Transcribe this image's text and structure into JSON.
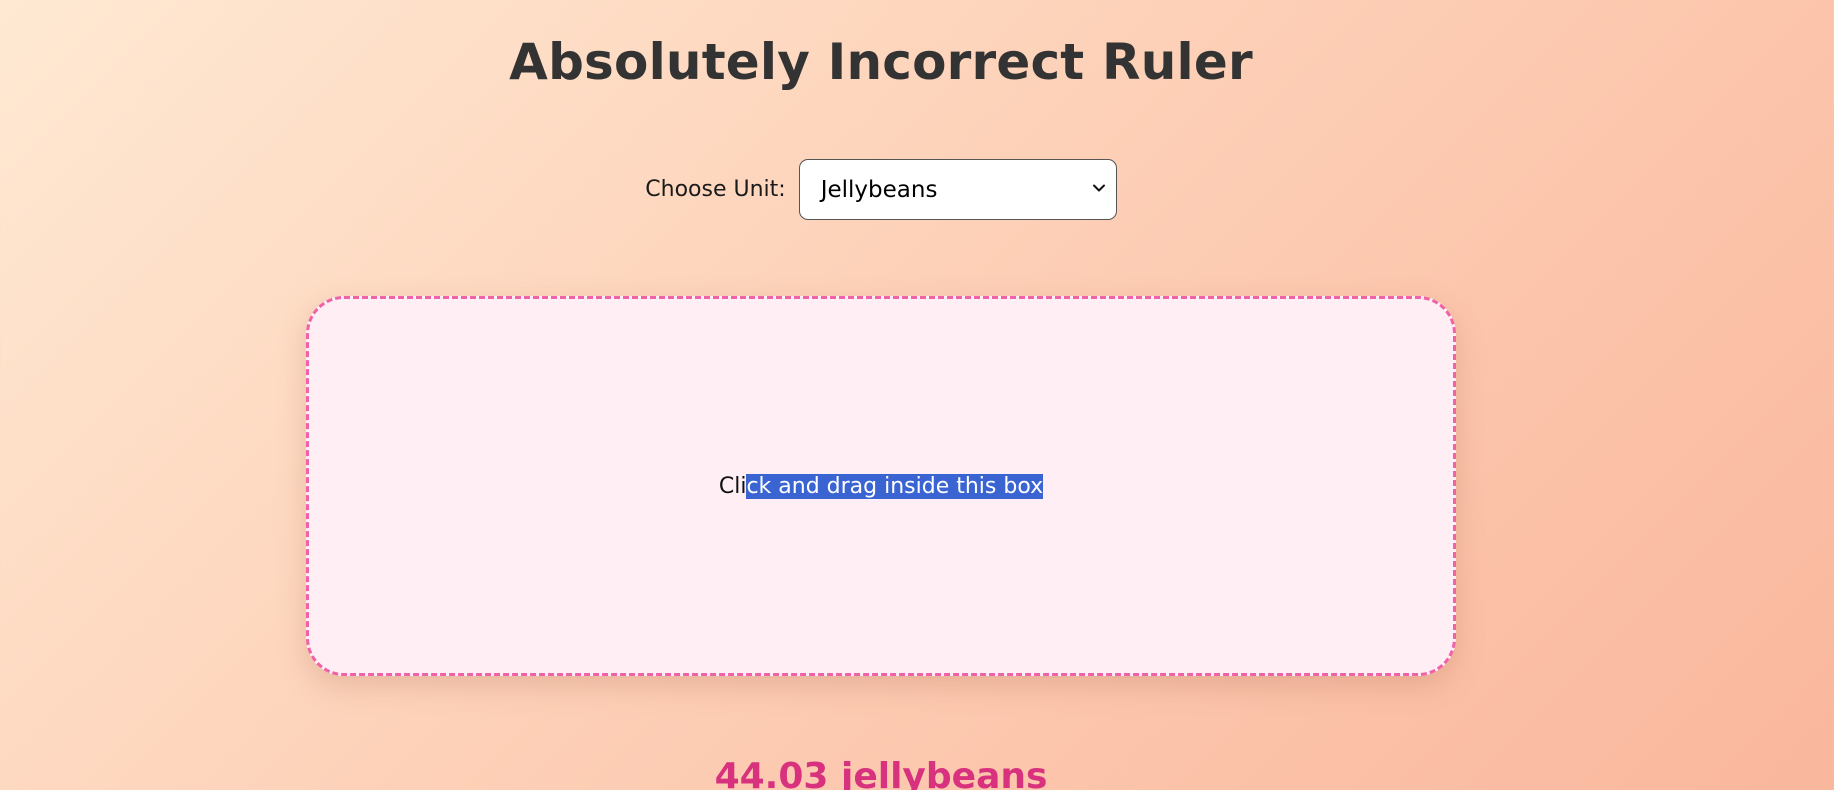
{
  "header": {
    "title": "Absolutely Incorrect Ruler"
  },
  "controls": {
    "unit_label": "Choose Unit:",
    "unit_selected": "Jellybeans",
    "unit_icon": "chevron-down-icon"
  },
  "measure_box": {
    "instruction_prefix": "Cli",
    "instruction_selected": "ck and drag inside this box"
  },
  "result": {
    "text": "44.03 jellybeans"
  },
  "colors": {
    "accent": "#f062a8",
    "result": "#d8327f",
    "selection": "#3a64d2",
    "box_background": "#ffeff4"
  }
}
